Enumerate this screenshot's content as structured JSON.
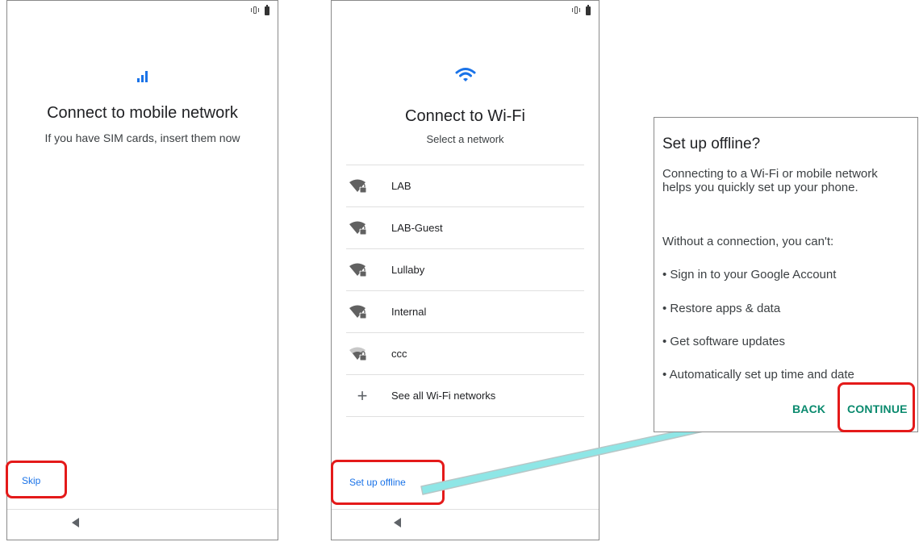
{
  "screen1": {
    "title": "Connect to mobile network",
    "subtitle": "If you have SIM cards, insert them now",
    "skip_label": "Skip"
  },
  "screen2": {
    "title": "Connect to Wi-Fi",
    "subtitle": "Select a network",
    "networks": [
      {
        "name": "LAB",
        "icon": "wifi-locked-icon"
      },
      {
        "name": "LAB-Guest",
        "icon": "wifi-locked-icon"
      },
      {
        "name": "Lullaby",
        "icon": "wifi-locked-icon"
      },
      {
        "name": "Internal",
        "icon": "wifi-locked-icon"
      },
      {
        "name": "ccc",
        "icon": "wifi-locked-weak-icon"
      }
    ],
    "see_all_label": "See all Wi-Fi networks",
    "offline_label": "Set up offline"
  },
  "dialog": {
    "title": "Set up offline?",
    "body": "Connecting to a Wi-Fi or mobile network helps you quickly set up your phone.",
    "without": "Without a connection, you can't:",
    "bullets": [
      "Sign in to your Google Account",
      "Restore apps & data",
      "Get software updates",
      "Automatically set up time and date"
    ],
    "back_label": "BACK",
    "continue_label": "CONTINUE"
  },
  "colors": {
    "accent_blue": "#1a73e8",
    "dialog_button": "#0a8a6e",
    "highlight_red": "#e41a1a",
    "arrow_cyan": "#8ee6e6"
  }
}
